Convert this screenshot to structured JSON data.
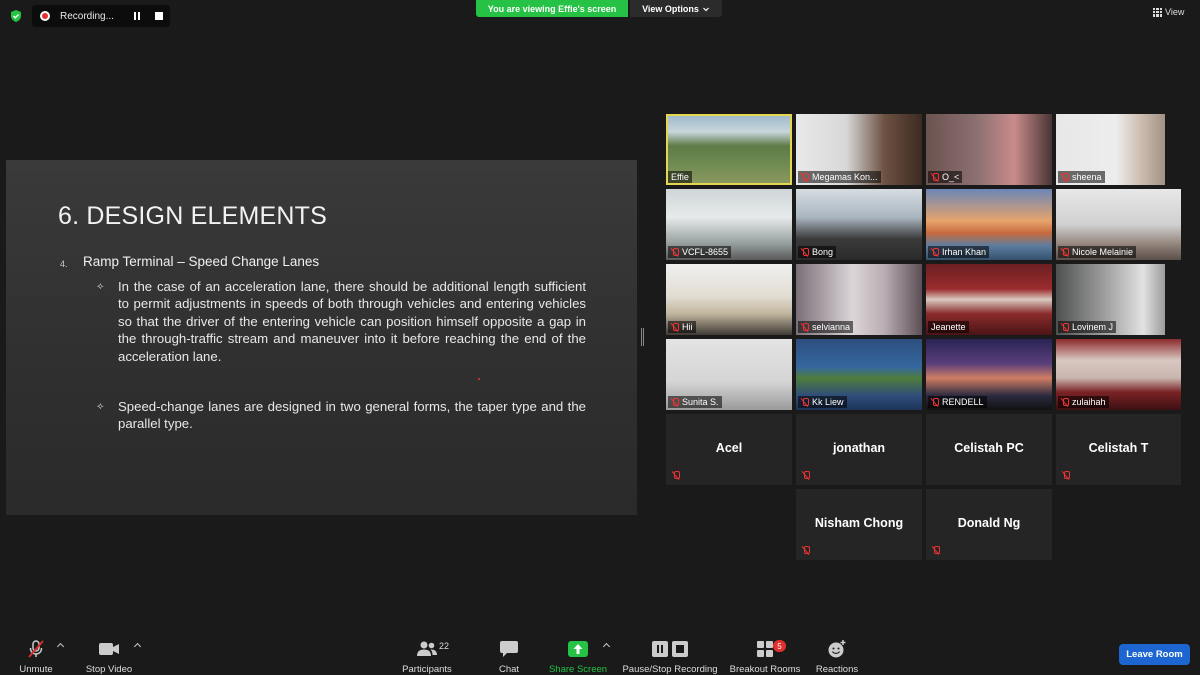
{
  "top_bar": {
    "recording_label": "Recording...",
    "viewing_banner": "You are viewing Effie's screen",
    "view_options_label": "View Options",
    "view_label": "View"
  },
  "slide": {
    "title": "6. DESIGN ELEMENTS",
    "number": "4.",
    "heading": "Ramp Terminal – Speed Change Lanes",
    "bullet_symbol": "⟡",
    "paragraphs": [
      "In the case of an acceleration lane, there should be additional length sufficient to permit adjustments in speeds of both through vehicles and entering vehicles so that the driver of the entering vehicle can position himself opposite a gap in the through-traffic stream and maneuver into it before reaching the end of the acceleration lane.",
      "Speed-change lanes are designed in two general forms, the taper type and the parallel type."
    ]
  },
  "participants_gallery": {
    "video_tiles": [
      {
        "name": "Effie",
        "muted": false
      },
      {
        "name": "Megamas Kon...",
        "muted": true
      },
      {
        "name": "O_<",
        "muted": true
      },
      {
        "name": "sheena",
        "muted": true
      },
      {
        "name": "VCFL-8655",
        "muted": true
      },
      {
        "name": "Bong",
        "muted": true
      },
      {
        "name": "Irhan Khan",
        "muted": true
      },
      {
        "name": "Nicole Melainie",
        "muted": true
      },
      {
        "name": "Hii",
        "muted": true
      },
      {
        "name": "selvianna",
        "muted": true
      },
      {
        "name": "Jeanette",
        "muted": false
      },
      {
        "name": "Lovinem J",
        "muted": true
      },
      {
        "name": "Sunita S.",
        "muted": true
      },
      {
        "name": "Kk Liew",
        "muted": true
      },
      {
        "name": "RENDELL",
        "muted": true
      },
      {
        "name": "zulaihah",
        "muted": true
      }
    ],
    "name_tiles": [
      {
        "name": "Acel"
      },
      {
        "name": "jonathan"
      },
      {
        "name": "Celistah PC"
      },
      {
        "name": "Celistah T"
      },
      {
        "name": "Nisham Chong"
      },
      {
        "name": "Donald Ng"
      }
    ]
  },
  "toolbar": {
    "unmute_label": "Unmute",
    "stop_video_label": "Stop Video",
    "participants_label": "Participants",
    "participants_count": "22",
    "chat_label": "Chat",
    "share_screen_label": "Share Screen",
    "pause_stop_recording_label": "Pause/Stop Recording",
    "breakout_rooms_label": "Breakout Rooms",
    "breakout_badge": "5",
    "reactions_label": "Reactions",
    "leave_room_label": "Leave Room"
  },
  "colors": {
    "accent_green": "#26c245",
    "leave_blue": "#1d66d1",
    "muted_red": "#e02f2f",
    "active_speaker_yellow": "#e4d650"
  }
}
